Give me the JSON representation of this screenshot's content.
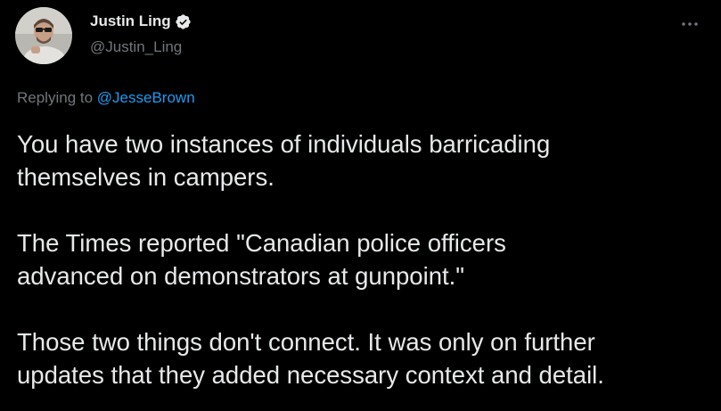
{
  "author": {
    "display_name": "Justin Ling",
    "handle": "@Justin_Ling",
    "verified": true
  },
  "reply": {
    "prefix": "Replying to",
    "mention": "@JesseBrown"
  },
  "tweet": {
    "paragraphs": [
      "You have two instances of individuals barricading\nthemselves in campers.",
      "The Times reported \"Canadian police officers\nadvanced on demonstrators at gunpoint.\"",
      "Those two things don't connect. It was only on further\nupdates that they added necessary context and detail."
    ]
  },
  "colors": {
    "background": "#000000",
    "text": "#e7e9ea",
    "muted": "#71767b",
    "accent": "#1d9bf0"
  },
  "icons": {
    "verified": "verified-badge-icon",
    "more": "more-dots-icon"
  }
}
